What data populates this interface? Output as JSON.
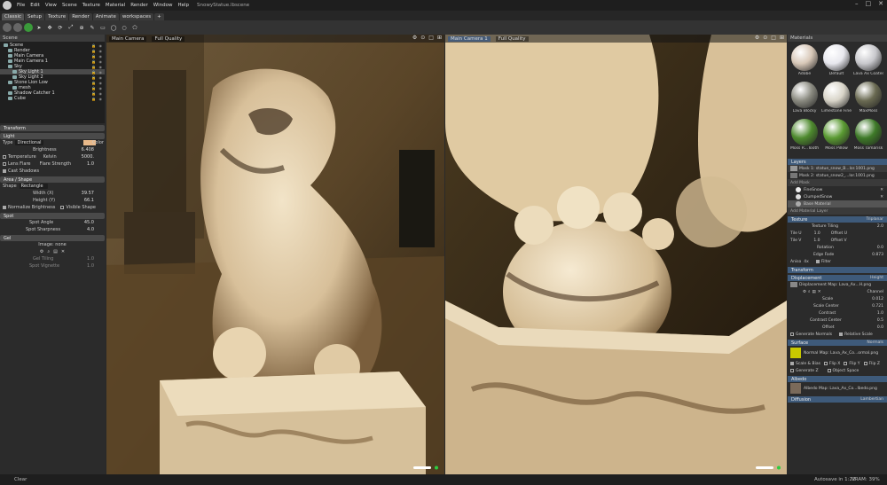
{
  "menu": {
    "items": [
      "File",
      "Edit",
      "View",
      "Scene",
      "Texture",
      "Material",
      "Render",
      "Window",
      "Help"
    ],
    "doc_title": "SnowyStatue.lbscene"
  },
  "workspace_tabs": [
    "Classic",
    "Setup",
    "Texture",
    "Render",
    "Animate",
    "workspaces",
    "+"
  ],
  "scene_panel": {
    "title": "Scene",
    "tree": [
      {
        "label": "Scene",
        "indent": 0
      },
      {
        "label": "Render",
        "indent": 1
      },
      {
        "label": "Main Camera",
        "indent": 1
      },
      {
        "label": "Main Camera 1",
        "indent": 1
      },
      {
        "label": "Sky",
        "indent": 1
      },
      {
        "label": "Sky Light 1",
        "indent": 2,
        "selected": true
      },
      {
        "label": "Sky Light 2",
        "indent": 2
      },
      {
        "label": "Stone Lion Low",
        "indent": 1
      },
      {
        "label": "mesh",
        "indent": 2
      },
      {
        "label": "Shadow Catcher 1",
        "indent": 1
      },
      {
        "label": "Cube",
        "indent": 1
      }
    ]
  },
  "properties": {
    "transform_label": "Transform",
    "light_label": "Light",
    "type_label": "Type",
    "type_value": "Directional",
    "color_label": "Color",
    "brightness_label": "Brightness",
    "brightness_value": "6.408",
    "temperature_label": "Temperature",
    "kelvin_label": "Kelvin",
    "kelvin_value": "5000.",
    "lens_flare_label": "Lens Flare",
    "flare_strength_label": "Flare Strength",
    "flare_strength_value": "1.0",
    "cast_shadows_label": "Cast Shadows",
    "area_shape_label": "Area / Shape",
    "shape_label": "Shape",
    "shape_value": "Rectangle",
    "width_label": "Width (X)",
    "width_value": "39.57",
    "height_label": "Height (Y)",
    "height_value": "66.1",
    "normalize_label": "Normalize Brightness",
    "visible_shape_label": "Visible Shape",
    "spot_label": "Spot",
    "spot_angle_label": "Spot Angle",
    "spot_angle_value": "45.0",
    "spot_sharpness_label": "Spot Sharpness",
    "spot_sharpness_value": "4.0",
    "gel_label": "Gel",
    "image_label": "Image: none",
    "gel_tiling_label": "Gel Tiling",
    "gel_tiling_value": "1.0",
    "spot_vignette_label": "Spot Vignette",
    "spot_vignette_value": "1.0"
  },
  "viewport_left": {
    "camera": "Main Camera",
    "quality": "Full Quality"
  },
  "viewport_right": {
    "camera": "Main Camera 1",
    "quality": "Full Quality"
  },
  "materials_panel": {
    "title": "Materials",
    "materials": [
      {
        "label": "Adobe",
        "color": "#d8c8b8"
      },
      {
        "label": "Default",
        "color": "#e8e8ee"
      },
      {
        "label": "Lava Ax Coated",
        "color": "#c8c8cc"
      },
      {
        "label": "Lava Blocky",
        "color": "#8a8a80"
      },
      {
        "label": "Limestone Fine",
        "color": "#d8d4c8"
      },
      {
        "label": "MaxMoss",
        "color": "#6a6a52"
      },
      {
        "label": "Moss R...Tooth",
        "color": "#4e8a2e"
      },
      {
        "label": "Moss Pillow",
        "color": "#5a9a32"
      },
      {
        "label": "Moss Tamarisk",
        "color": "#3e7a28"
      }
    ],
    "layers_label": "Layers",
    "mask1": "Mask 1: statue_snow_B...lor.1001.png",
    "mask2": "Mask 2: statue_snow2_...lor.1001.png",
    "add_mask": "Add Mask",
    "fine_snow": "FineSnow",
    "clumped_snow": "ClumpedSnow",
    "base_material": "Base Material",
    "add_material_layer": "Add Material Layer",
    "texture_label": "Texture",
    "triplanar_label": "Triplanar",
    "texture_tiling_label": "Texture Tiling",
    "texture_tiling_value": "2.0",
    "tile_u_label": "Tile U",
    "tile_u_value": "1.0",
    "offset_u_label": "Offset U",
    "tile_v_label": "Tile V",
    "tile_v_value": "1.0",
    "offset_v_label": "Offset V",
    "rotation_label": "Rotation",
    "rotation_value": "0.0",
    "edge_fade_label": "Edge Fade",
    "edge_fade_value": "0.873",
    "aniso_label": "Aniso",
    "aniso_value": "4x",
    "filter_label": "Filter",
    "transform_label": "Transform",
    "displacement_label": "Displacement",
    "height_tag": "Height",
    "disp_map": "Displacement Map: Lava_Ax...H.png",
    "channel_label": "Channel",
    "scale_label": "Scale",
    "scale_value": "0.012",
    "scale_center_label": "Scale Center",
    "scale_center_value": "0.721",
    "contrast_label": "Contrast",
    "contrast_value": "1.0",
    "contrast_center_label": "Contrast Center",
    "contrast_center_value": "0.5",
    "offset_label": "Offset",
    "offset_value": "0.0",
    "generate_normals_label": "Generate Normals",
    "relative_scale_label": "Relative Scale",
    "surface_label": "Surface",
    "normals_tag": "Normals",
    "normal_map": "Normal Map: Lava_Ax_Co...ormal.png",
    "scale_bias_label": "Scale & Bias",
    "flip_x_label": "Flip X",
    "flip_y_label": "Flip Y",
    "flip_z_label": "Flip Z",
    "generate_z_label": "Generate Z",
    "object_space_label": "Object Space",
    "albedo_label": "Albedo",
    "albedo_map": "Albedo Map: Lava_Ax_Co...lbedo.png",
    "diffusion_label": "Diffusion",
    "lambertian_label": "Lambertian"
  },
  "status": {
    "clear_label": "Clear",
    "autosave": "Autosave in 1:22",
    "vram": "VRAM: 39%"
  }
}
